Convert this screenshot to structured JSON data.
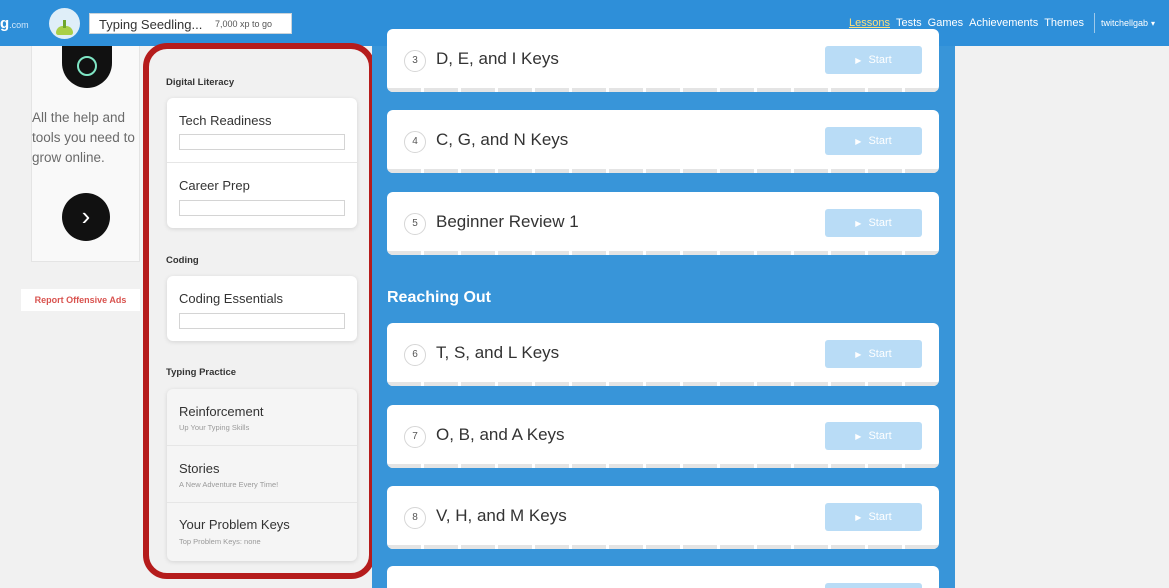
{
  "topbar": {
    "logo_text": "g",
    "logo_suffix": ".com",
    "rank": "Typing Seedling...",
    "xp_to_go": "7,000 xp to go",
    "nav": [
      "Lessons",
      "Tests",
      "Games",
      "Achievements",
      "Themes"
    ],
    "active_nav": "Lessons",
    "username": "twitchellgab",
    "user_caret": "▾"
  },
  "ad": {
    "text": "All the help and tools you need to grow online.",
    "arrow": "›"
  },
  "report_label": "Report Offensive Ads",
  "sidebar": {
    "digital_literacy": {
      "heading": "Digital Literacy",
      "items": [
        {
          "label": "Tech Readiness"
        },
        {
          "label": "Career Prep"
        }
      ]
    },
    "coding": {
      "heading": "Coding",
      "items": [
        {
          "label": "Coding Essentials"
        }
      ]
    },
    "typing_practice": {
      "heading": "Typing Practice",
      "items": [
        {
          "label": "Reinforcement",
          "sub": "Up Your Typing Skills"
        },
        {
          "label": "Stories",
          "sub": "A New Adventure Every Time!"
        },
        {
          "label": "Your Problem Keys",
          "sub": "Top Problem Keys: none"
        }
      ]
    }
  },
  "lessons_panel": {
    "start_label": "Start",
    "play_glyph": "▶",
    "section_reaching_out": "Reaching Out",
    "lessons": [
      {
        "num": "3",
        "name": "D, E, and I Keys"
      },
      {
        "num": "4",
        "name": "C, G, and N Keys"
      },
      {
        "num": "5",
        "name": "Beginner Review 1"
      },
      {
        "num": "6",
        "name": "T, S, and L Keys"
      },
      {
        "num": "7",
        "name": "O, B, and A Keys"
      },
      {
        "num": "8",
        "name": "V, H, and M Keys"
      }
    ]
  },
  "colors": {
    "topbar": "#2e8fd9",
    "panel": "#3895d9",
    "highlight": "#b51c1c",
    "start_button": "#b9dcf6"
  }
}
